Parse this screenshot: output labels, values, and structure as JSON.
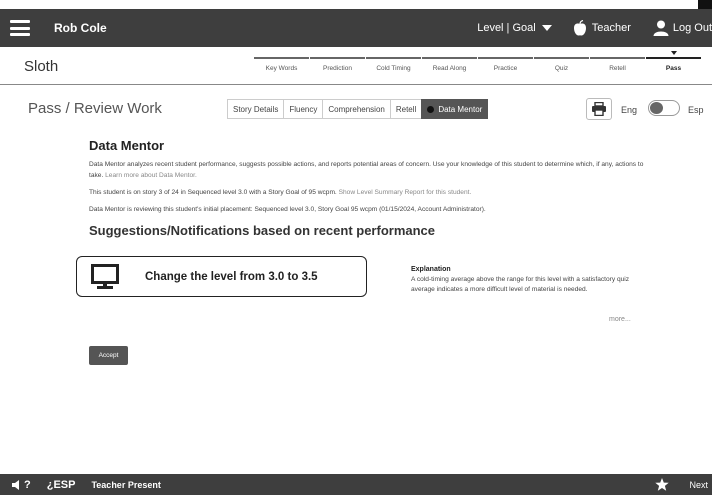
{
  "header": {
    "user_name": "Rob Cole",
    "level_goal": "Level | Goal",
    "teacher": "Teacher",
    "logout": "Log Out"
  },
  "story": {
    "title": "Sloth",
    "steps": [
      "Key Words",
      "Prediction",
      "Cold Timing",
      "Read Along",
      "Practice",
      "Quiz",
      "Retell",
      "Pass"
    ],
    "active_step": "Pass"
  },
  "pass": {
    "title": "Pass / Review Work",
    "tabs": [
      "Story Details",
      "Fluency",
      "Comprehension",
      "Retell",
      "Data Mentor"
    ],
    "active_tab": "Data Mentor",
    "lang_eng": "Eng",
    "lang_esp": "Esp"
  },
  "mentor": {
    "title": "Data Mentor",
    "intro": "Data Mentor analyzes recent student performance, suggests possible actions, and reports potential areas of concern. Use your knowledge of this student to determine which, if any, actions to take. ",
    "intro_link": "Learn more about Data Mentor.",
    "story_info": "This student is on story 3 of 24 in Sequenced level 3.0 with a Story Goal of 95 wcpm. ",
    "story_info_link": "Show Level Summary Report for this student.",
    "placement_info": "Data Mentor is reviewing this student's initial placement: Sequenced level 3.0, Story Goal 95 wcpm (01/15/2024, Account Administrator).",
    "suggestions_title": "Suggestions/Notifications based on recent performance",
    "suggestion": "Change the level from 3.0 to 3.5",
    "explanation_head": "Explanation",
    "explanation_text": "A cold-timing average above the range for this level with a satisfactory quiz average indicates a more difficult level of material is needed.",
    "more": "more...",
    "accept": "Accept"
  },
  "footer": {
    "question": "?",
    "esp": "¿ESP",
    "teacher_present": "Teacher Present",
    "next": "Next"
  },
  "colors": {
    "bar_bg": "#3e3e3e",
    "tab_active": "#555555",
    "link": "#888888"
  }
}
